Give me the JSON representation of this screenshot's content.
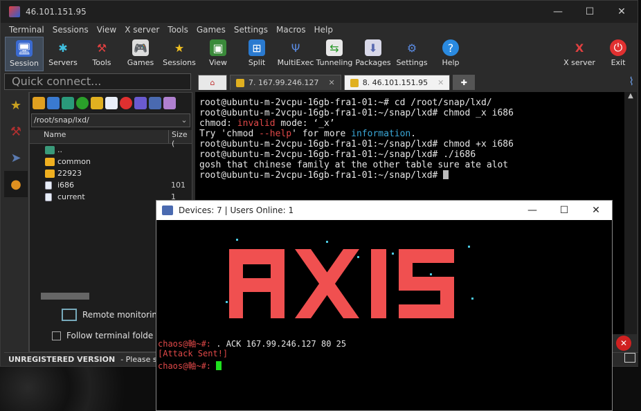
{
  "window": {
    "title": "46.101.151.95"
  },
  "menu": [
    "Terminal",
    "Sessions",
    "View",
    "X server",
    "Tools",
    "Games",
    "Settings",
    "Macros",
    "Help"
  ],
  "toolbar": [
    {
      "label": "Session",
      "icon": "session-icon"
    },
    {
      "label": "Servers",
      "icon": "servers-icon"
    },
    {
      "label": "Tools",
      "icon": "tools-icon"
    },
    {
      "label": "Games",
      "icon": "gamepad-icon"
    },
    {
      "label": "Sessions",
      "icon": "star-icon"
    },
    {
      "label": "View",
      "icon": "view-icon"
    },
    {
      "label": "Split",
      "icon": "split-icon"
    },
    {
      "label": "MultiExec",
      "icon": "multiexec-icon"
    },
    {
      "label": "Tunneling",
      "icon": "tunneling-icon"
    },
    {
      "label": "Packages",
      "icon": "packages-icon"
    },
    {
      "label": "Settings",
      "icon": "gears-icon"
    },
    {
      "label": "Help",
      "icon": "help-icon"
    }
  ],
  "toolbar_right": [
    {
      "label": "X server",
      "icon": "xserver-icon"
    },
    {
      "label": "Exit",
      "icon": "power-icon"
    }
  ],
  "quick_connect": {
    "placeholder": "Quick connect..."
  },
  "tabs": [
    {
      "label": "7. 167.99.246.127"
    },
    {
      "label": "8. 46.101.151.95"
    }
  ],
  "sftp": {
    "path": "/root/snap/lxd/",
    "columns": {
      "name": "Name",
      "size": "Size ("
    },
    "rows": [
      {
        "name": "..",
        "size": "",
        "type": "up"
      },
      {
        "name": "common",
        "size": "",
        "type": "folder"
      },
      {
        "name": "22923",
        "size": "",
        "type": "folder"
      },
      {
        "name": "i686",
        "size": "101",
        "type": "file"
      },
      {
        "name": "current",
        "size": "1",
        "type": "link"
      }
    ],
    "remote_monitoring": "Remote monitoring",
    "follow_folder": "Follow terminal folde"
  },
  "status": {
    "unregistered": "UNREGISTERED VERSION",
    "support": "-  Please suppo"
  },
  "terminal": {
    "lines": [
      "root@ubuntu-m-2vcpu-16gb-fra1-01:~# cd /root/snap/lxd/",
      "root@ubuntu-m-2vcpu-16gb-fra1-01:~/snap/lxd# chmod _x i686",
      "root@ubuntu-m-2vcpu-16gb-fra1-01:~/snap/lxd# chmod +x i686",
      "root@ubuntu-m-2vcpu-16gb-fra1-01:~/snap/lxd# ./i686",
      "gosh that chinese family at the other table sure ate alot",
      "root@ubuntu-m-2vcpu-16gb-fra1-01:~/snap/lxd# "
    ],
    "chmod_err": {
      "a": "chmod: ",
      "b": "invalid",
      "c": " mode: ‘_x’"
    },
    "try": {
      "a": "Try 'chmod ",
      "b": "--help",
      "c": "' for more ",
      "d": "information",
      "e": "."
    }
  },
  "cnc": {
    "title": "Devices: 7 | Users Online: 1",
    "banner": "AXIS",
    "prompt": "chaos@軸~#:",
    "command": " . ACK 167.99.246.127 80 25",
    "result": "[Attack Sent!]"
  },
  "colors": {
    "accent_red": "#e04848",
    "cursor_green": "#1ee01e",
    "info_blue": "#3aa8d8"
  }
}
